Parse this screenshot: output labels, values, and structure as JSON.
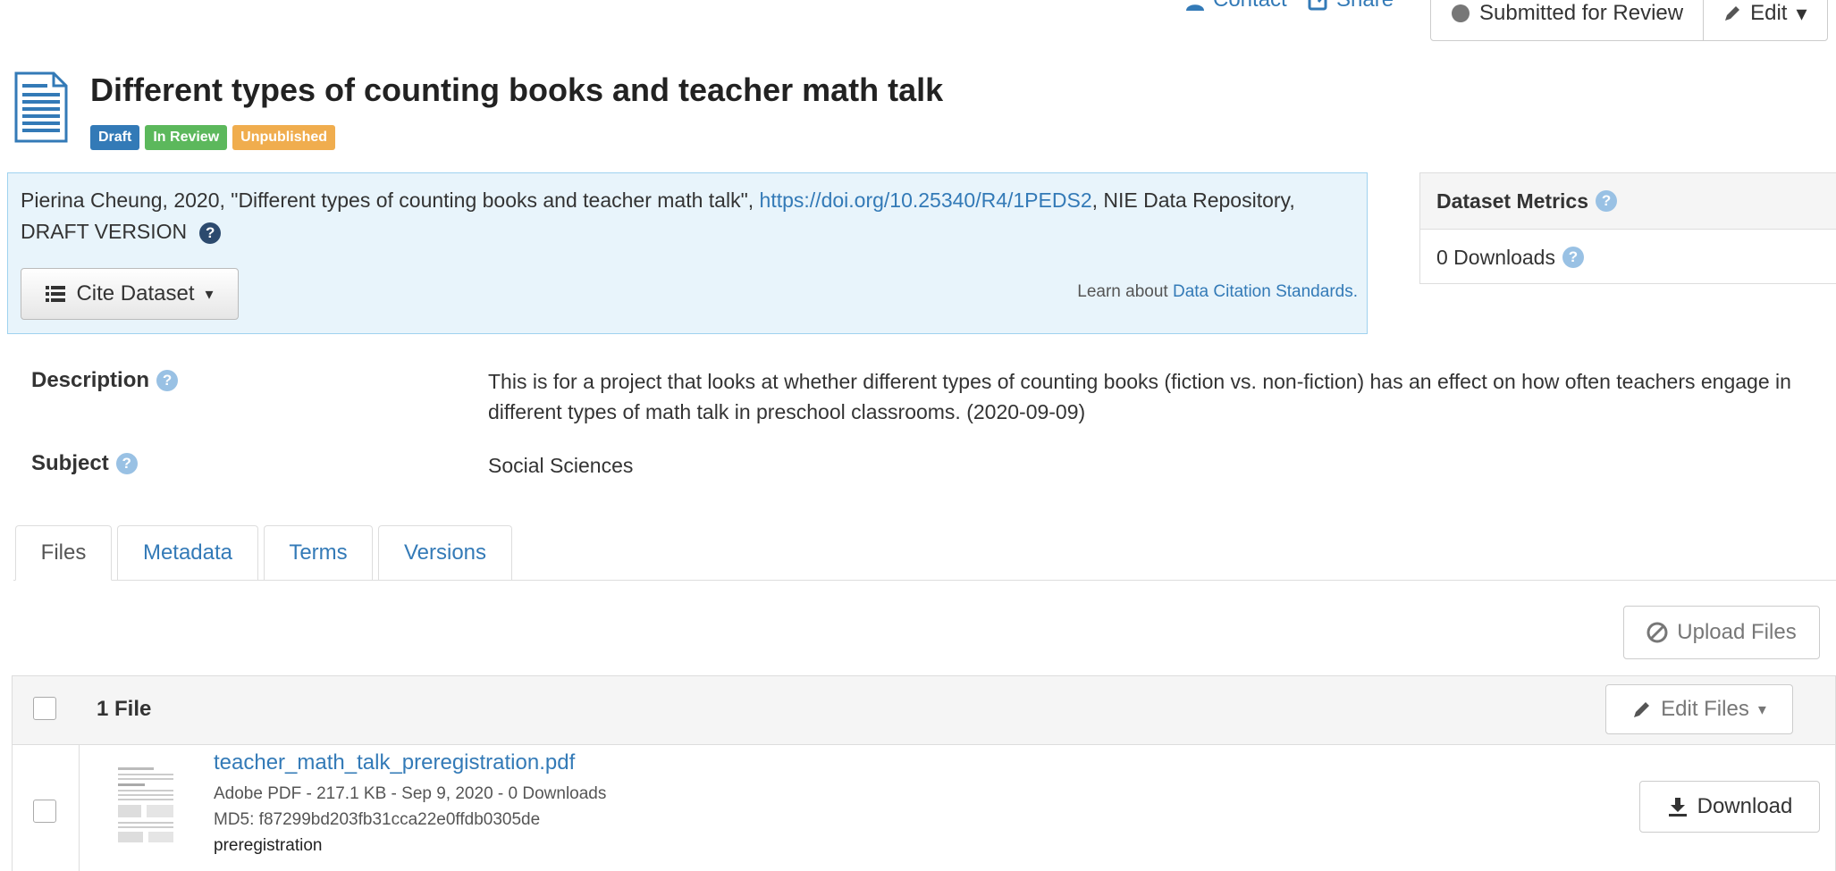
{
  "top_bar": {
    "contact_label": "Contact",
    "share_label": "Share",
    "submitted_label": "Submitted for Review",
    "edit_label": "Edit"
  },
  "dataset": {
    "title": "Different types of counting books and teacher math talk",
    "badges": [
      "Draft",
      "In Review",
      "Unpublished"
    ]
  },
  "citation": {
    "text_before": "Pierina Cheung, 2020, \"Different types of counting books and teacher math talk\", ",
    "doi_link": "https://doi.org/10.25340/R4/1PEDS2",
    "text_after": ", NIE Data Repository, DRAFT VERSION",
    "cite_button": "Cite Dataset",
    "learn_prefix": "Learn about ",
    "learn_link": "Data Citation Standards."
  },
  "metrics": {
    "title": "Dataset Metrics",
    "downloads": "0 Downloads"
  },
  "details": {
    "description_label": "Description",
    "description_value": "This is for a project that looks at whether different types of counting books (fiction vs. non-fiction) has an effect on how often teachers engage in different types of math talk in preschool classrooms. (2020-09-09)",
    "subject_label": "Subject",
    "subject_value": "Social Sciences"
  },
  "tabs": [
    "Files",
    "Metadata",
    "Terms",
    "Versions"
  ],
  "files": {
    "upload_button": "Upload Files",
    "count_label": "1 File",
    "edit_files_button": "Edit Files",
    "items": [
      {
        "name": "teacher_math_talk_preregistration.pdf",
        "info": "Adobe PDF - 217.1 KB - Sep 9, 2020 - 0 Downloads",
        "md5": "MD5: f87299bd203fb31cca22e0ffdb0305de",
        "tag": "preregistration",
        "download_button": "Download"
      }
    ]
  },
  "colors": {
    "link": "#337ab7",
    "draft": "#337ab7",
    "in_review": "#5cb85c",
    "unpublished": "#f0ad4e",
    "citation_bg": "#e8f4fb"
  }
}
